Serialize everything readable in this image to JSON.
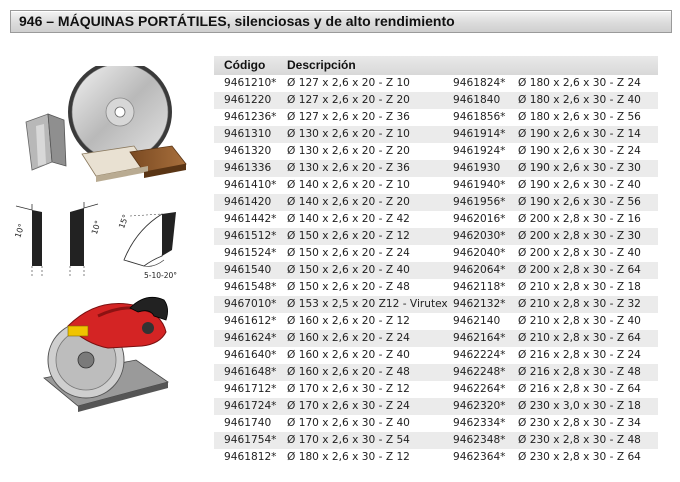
{
  "header": {
    "title": "946 – MÁQUINAS PORTÁTILES, silenciosas y de alto rendimiento"
  },
  "table": {
    "col_code": "Código",
    "col_desc": "Descripción",
    "rows": [
      [
        "9461210*",
        "Ø 127 x 2,6 x 20 - Z 10",
        "9461824*",
        "Ø 180 x 2,6 x 30 - Z 24"
      ],
      [
        "9461220",
        "Ø 127 x 2,6 x 20 - Z 20",
        "9461840",
        "Ø 180 x 2,6 x 30 - Z 40"
      ],
      [
        "9461236*",
        "Ø 127 x 2,6 x 20 - Z 36",
        "9461856*",
        "Ø 180 x 2,6 x 30 - Z 56"
      ],
      [
        "9461310",
        "Ø 130 x 2,6 x 20 - Z 10",
        "9461914*",
        "Ø 190 x 2,6 x 30 - Z 14"
      ],
      [
        "9461320",
        "Ø 130 x 2,6 x 20 - Z 20",
        "9461924*",
        "Ø 190 x 2,6 x 30 - Z 24"
      ],
      [
        "9461336",
        "Ø 130 x 2,6 x 20 - Z 36",
        "9461930",
        "Ø 190 x 2,6 x 30 - Z 30"
      ],
      [
        "9461410*",
        "Ø 140 x 2,6 x 20 - Z 10",
        "9461940*",
        "Ø 190 x 2,6 x 30 - Z 40"
      ],
      [
        "9461420",
        "Ø 140 x 2,6 x 20 - Z 20",
        "9461956*",
        "Ø 190 x 2,6 x 30 - Z 56"
      ],
      [
        "9461442*",
        "Ø 140 x 2,6 x 20 - Z 42",
        "9462016*",
        "Ø 200 x 2,8 x 30 - Z 16"
      ],
      [
        "9461512*",
        "Ø 150 x 2,6 x 20 - Z 12",
        "9462030*",
        "Ø 200 x 2,8 x 30 - Z 30"
      ],
      [
        "9461524*",
        "Ø 150 x 2,6 x 20 - Z 24",
        "9462040*",
        "Ø 200 x 2,8 x 30 - Z 40"
      ],
      [
        "9461540",
        "Ø 150 x 2,6 x 20 - Z 40",
        "9462064*",
        "Ø 200 x 2,8 x 30 - Z 64"
      ],
      [
        "9461548*",
        "Ø 150 x 2,6 x 20 - Z 48",
        "9462118*",
        "Ø 210 x 2,8 x 30 - Z 18"
      ],
      [
        "9467010*",
        "Ø 153 x 2,5 x 20 Z12 - Virutex",
        "9462132*",
        "Ø 210 x 2,8 x 30 - Z 32"
      ],
      [
        "9461612*",
        "Ø 160 x 2,6 x 20 - Z 12",
        "9462140",
        "Ø 210 x 2,8 x 30 - Z 40"
      ],
      [
        "9461624*",
        "Ø 160 x 2,6 x 20 - Z 24",
        "9462164*",
        "Ø 210 x 2,8 x 30 - Z 64"
      ],
      [
        "9461640*",
        "Ø 160 x 2,6 x 20 - Z 40",
        "9462224*",
        "Ø 216 x 2,8 x 30 - Z 24"
      ],
      [
        "9461648*",
        "Ø 160 x 2,6 x 20 - Z 48",
        "9462248*",
        "Ø 216 x 2,8 x 30 - Z 48"
      ],
      [
        "9461712*",
        "Ø 170 x 2,6 x 30 - Z 12",
        "9462264*",
        "Ø 216 x 2,8 x 30 - Z 64"
      ],
      [
        "9461724*",
        "Ø 170 x 2,6 x 30 - Z 24",
        "9462320*",
        "Ø 230 x 3,0 x 30 - Z 18"
      ],
      [
        "9461740",
        "Ø 170 x 2,6 x 30 - Z 40",
        "9462334*",
        "Ø 230 x 2,8 x 30 - Z 34"
      ],
      [
        "9461754*",
        "Ø 170 x 2,6 x 30 - Z 54",
        "9462348*",
        "Ø 230 x 2,8 x 30 - Z 48"
      ],
      [
        "9461812*",
        "Ø 180 x 2,6 x 30 - Z 12",
        "9462364*",
        "Ø 230 x 2,8 x 30 - Z 64"
      ]
    ]
  },
  "figures": {
    "angle_left": "10°",
    "angle_mid": "10°",
    "angle_right": "15°",
    "angle_range": "5-10-20°"
  }
}
